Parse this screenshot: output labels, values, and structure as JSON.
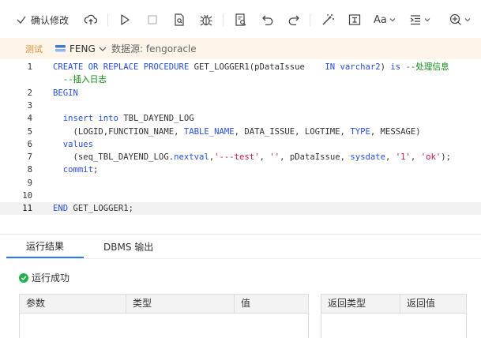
{
  "toolbar": {
    "confirm_label": "确认修改",
    "icons": [
      "check-icon",
      "upload-cloud-icon",
      "play-icon",
      "stop-icon",
      "explain-icon",
      "debug-icon",
      "find-icon",
      "undo-icon",
      "redo-icon",
      "magic-format-icon",
      "text-box-icon",
      "font-size-icon",
      "indent-icon",
      "add-icon"
    ],
    "font_label": "Aa"
  },
  "infobar": {
    "env_badge": "测试",
    "schema": "FENG",
    "datasource_label": "数据源: fengoracle"
  },
  "editor": {
    "active_line": 11,
    "lines": [
      {
        "n": "1",
        "tokens": [
          [
            "kw",
            "CREATE OR REPLACE PROCEDURE "
          ],
          [
            "tbl",
            "GET_LOGGER1(pDataIssue    "
          ],
          [
            "kw",
            "IN varchar2"
          ],
          [
            "tbl",
            ") "
          ],
          [
            "kw",
            "is "
          ],
          [
            "cmt",
            "--处理信息"
          ]
        ]
      },
      {
        "n": "",
        "tokens": [
          [
            "cmt",
            "  --插入日志"
          ]
        ]
      },
      {
        "n": "2",
        "tokens": [
          [
            "kw",
            "BEGIN"
          ]
        ]
      },
      {
        "n": "3",
        "tokens": []
      },
      {
        "n": "4",
        "tokens": [
          [
            "kw",
            "  insert into "
          ],
          [
            "tbl",
            "TBL_DAYEND_LOG"
          ]
        ]
      },
      {
        "n": "5",
        "tokens": [
          [
            "tbl",
            "    (LOGID,FUNCTION_NAME, "
          ],
          [
            "kw",
            "TABLE_NAME"
          ],
          [
            "tbl",
            ", DATA_ISSUE, LOGTIME, "
          ],
          [
            "kw",
            "TYPE"
          ],
          [
            "tbl",
            ", MESSAGE)"
          ]
        ]
      },
      {
        "n": "6",
        "tokens": [
          [
            "kw",
            "  values"
          ]
        ]
      },
      {
        "n": "7",
        "tokens": [
          [
            "tbl",
            "    (seq_TBL_DAYEND_LOG."
          ],
          [
            "kw",
            "nextval"
          ],
          [
            "tbl",
            ","
          ],
          [
            "str",
            "'---test'"
          ],
          [
            "tbl",
            ", "
          ],
          [
            "str",
            "''"
          ],
          [
            "tbl",
            ", pDataIssue, "
          ],
          [
            "kw",
            "sysdate"
          ],
          [
            "tbl",
            ", "
          ],
          [
            "str",
            "'1'"
          ],
          [
            "tbl",
            ", "
          ],
          [
            "str",
            "'ok'"
          ],
          [
            "tbl",
            ");"
          ]
        ]
      },
      {
        "n": "8",
        "tokens": [
          [
            "kw",
            "  commit"
          ],
          [
            "tbl",
            ";"
          ]
        ]
      },
      {
        "n": "9",
        "tokens": []
      },
      {
        "n": "10",
        "tokens": []
      },
      {
        "n": "11",
        "tokens": [
          [
            "kw",
            "END "
          ],
          [
            "tbl",
            "GET_LOGGER1;"
          ]
        ]
      }
    ]
  },
  "result": {
    "tabs": [
      {
        "label": "运行结果",
        "active": true
      },
      {
        "label": "DBMS 输出",
        "active": false
      }
    ],
    "status": "运行成功",
    "params_headers": [
      "参数",
      "类型",
      "值"
    ],
    "return_headers": [
      "返回类型",
      "返回值"
    ]
  },
  "colors": {
    "accent": "#2979ff",
    "success": "#22b14c",
    "env": "#e08a2c",
    "keyword": "#2a4fd8",
    "string": "#c2185b",
    "comment": "#0f8a0f"
  }
}
